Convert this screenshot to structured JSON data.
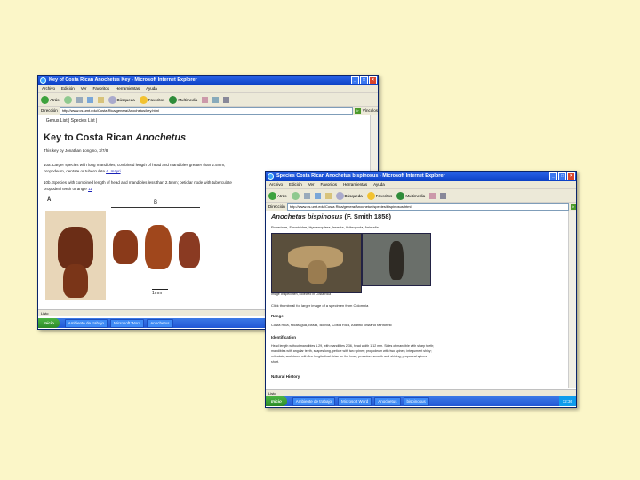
{
  "window1": {
    "title": "Key of Costa Rican Anochetus Key - Microsoft Internet Explorer",
    "menu": [
      "Archivo",
      "Edición",
      "Ver",
      "Favoritos",
      "Herramientas",
      "Ayuda"
    ],
    "toolbar": {
      "back": "Atrás",
      "search": "Búsqueda",
      "favorites": "Favoritos",
      "multimedia": "Multimedia"
    },
    "address_label": "Dirección",
    "address": "http://www.cs.umt.edu/Costa Rica/genera/Anochetus/key.html",
    "go": "Ir",
    "links_label": "Vínculos",
    "nav": "| Genus List | Species List |",
    "heading_plain": "Key to Costa Rican ",
    "heading_italic": "Anochetus",
    "author": "This key by Jonathan Longino, 3/7/8",
    "couplet1_num": "10a.",
    "couplet1_text": "Larger species with long mandibles; combined length of head and mandibles greater than 2.5mm;",
    "couplet1_text2": "propodeum, dentate or tuberculate",
    "couplet1_link": "A. mayri",
    "couplet2_num": "10b.",
    "couplet2_text": "Species with combined length of head and mandibles less than 2.5mm; petiolar node with tuberculate",
    "couplet2_text2": "propodeal teeth or angle",
    "couplet2_link": "11",
    "fig_label_a": "A",
    "fig_label_b": "B",
    "scale": "1mm",
    "status": "Listo"
  },
  "taskbar1": {
    "start": "Inicio",
    "tasks": [
      "Ambiente de trabajo",
      "Microsoft Word",
      "Anochetus"
    ],
    "tray": "12:34"
  },
  "window2": {
    "title": "Species Costa Rican Anochetus bispinosus - Microsoft Internet Explorer",
    "menu": [
      "Archivo",
      "Edición",
      "Ver",
      "Favoritos",
      "Herramientas",
      "Ayuda"
    ],
    "toolbar": {
      "back": "Atrás",
      "search": "Búsqueda",
      "favorites": "Favoritos",
      "multimedia": "Multimedia"
    },
    "address_label": "Dirección",
    "address": "http://www.cs.umt.edu/Costa Rica/genera/Anochetus/species/bispinosus.html",
    "go": "Ir",
    "heading_italic": "Anochetus bispinosus",
    "heading_plain": " (F. Smith 1858)",
    "taxonomy": "Ponerinae, Formicidae, Hymenoptera, Insecta, Arthropoda, Animalia",
    "photo_caption": "Image of specimen, collected in Costa Rica",
    "photo_subcaption": "Click thumbnail for larger image of a specimen from Colombia",
    "range_title": "Range",
    "range_text": "Costa Rica, Nicaragua, Brazil, Bolivia, Costa Rica, Atlantic lowland rainforest",
    "id_title": "Identification",
    "id_text1": "Head length without mandibles 1.29, with mandibles 2.36, head width 1.12 mm. Sides of mandible with sharp teeth;",
    "id_text2": "mandibles with angular teeth, scapes long, petiole with two spines; propodeum with two spines; integument shiny;",
    "id_text3": "reticulate, sculptured with fine longitudinal striae on the head; pronotum smooth and shining; propodeal spines",
    "id_text4": "short.",
    "nh_title": "Natural History",
    "status": "Listo"
  },
  "taskbar2": {
    "start": "Inicio",
    "tasks": [
      "Ambiente de trabajo",
      "Microsoft Word",
      "Anochetus",
      "bispinosus"
    ],
    "tray": "12:36"
  },
  "colors": {
    "desktop": "#fbf6c8",
    "titlebar": "#0b3fc4",
    "link": "#1a23b8",
    "taskbar": "#2157d6",
    "start": "#2d8a2a"
  }
}
